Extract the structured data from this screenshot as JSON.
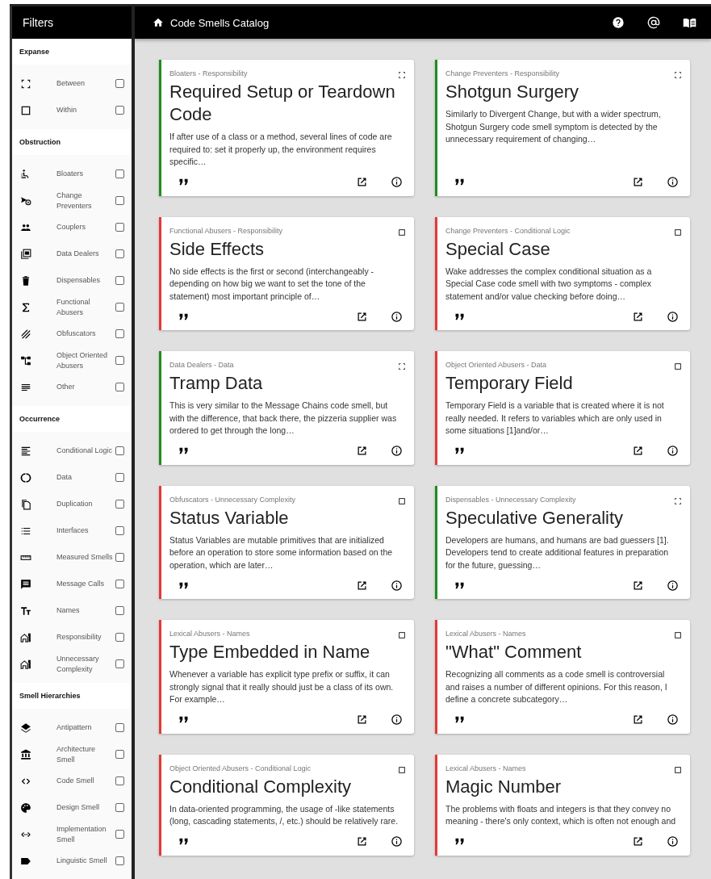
{
  "sidebar": {
    "title": "Filters",
    "sections": [
      {
        "title": "Expanse",
        "items": [
          {
            "label": "Between",
            "checked": false
          },
          {
            "label": "Within",
            "checked": false
          }
        ]
      },
      {
        "title": "Obstruction",
        "items": [
          {
            "label": "Bloaters",
            "checked": false
          },
          {
            "label": "Change Preventers",
            "checked": false
          },
          {
            "label": "Couplers",
            "checked": false
          },
          {
            "label": "Data Dealers",
            "checked": false
          },
          {
            "label": "Dispensables",
            "checked": false
          },
          {
            "label": "Functional Abusers",
            "checked": false
          },
          {
            "label": "Obfuscators",
            "checked": false
          },
          {
            "label": "Object Oriented Abusers",
            "checked": false
          },
          {
            "label": "Other",
            "checked": false
          }
        ]
      },
      {
        "title": "Occurrence",
        "items": [
          {
            "label": "Conditional Logic",
            "checked": false
          },
          {
            "label": "Data",
            "checked": false
          },
          {
            "label": "Duplication",
            "checked": false
          },
          {
            "label": "Interfaces",
            "checked": false
          },
          {
            "label": "Measured Smells",
            "checked": false
          },
          {
            "label": "Message Calls",
            "checked": false
          },
          {
            "label": "Names",
            "checked": false
          },
          {
            "label": "Responsibility",
            "checked": false
          },
          {
            "label": "Unnecessary Complexity",
            "checked": false
          }
        ]
      },
      {
        "title": "Smell Hierarchies",
        "items": [
          {
            "label": "Antipattern",
            "checked": false
          },
          {
            "label": "Architecture Smell",
            "checked": false
          },
          {
            "label": "Code Smell",
            "checked": false
          },
          {
            "label": "Design Smell",
            "checked": false
          },
          {
            "label": "Implementation Smell",
            "checked": false
          },
          {
            "label": "Linguistic Smell",
            "checked": false
          }
        ]
      }
    ]
  },
  "header": {
    "title": "Code Smells Catalog"
  },
  "cards": [
    {
      "category": "Bloaters - Responsibility",
      "title": "Required Setup or Teardown Code",
      "description": "If after use of a class or a method, several lines of code are required to: set it properly up, the environment requires specific…",
      "color": "#1e8e1e",
      "kind": "between"
    },
    {
      "category": "Change Preventers - Responsibility",
      "title": "Shotgun Surgery",
      "description": "Similarly to Divergent Change, but with a wider spectrum, Shotgun Surgery code smell symptom is detected by the unnecessary requirement of changing…",
      "color": "#1e8e1e",
      "kind": "between"
    },
    {
      "category": "Functional Abusers - Responsibility",
      "title": "Side Effects",
      "description": "No side effects is the first or second (interchangeably - depending on how big we want to set the tone of the statement) most important principle of…",
      "color": "#e53935",
      "kind": "within"
    },
    {
      "category": "Change Preventers - Conditional Logic",
      "title": "Special Case",
      "description": "Wake addresses the complex conditional situation as a Special Case code smell with two symptoms - complex statement and/or value checking before doing…",
      "color": "#e53935",
      "kind": "within"
    },
    {
      "category": "Data Dealers - Data",
      "title": "Tramp Data",
      "description": "This is very similar to the Message Chains code smell, but with the difference, that back there, the pizzeria supplier was ordered to get through the long…",
      "color": "#1e8e1e",
      "kind": "between"
    },
    {
      "category": "Object Oriented Abusers - Data",
      "title": "Temporary Field",
      "description": "Temporary Field is a variable that is created where it is not really needed. It refers to variables which are only used in some situations [1]and/or…",
      "color": "#e53935",
      "kind": "within"
    },
    {
      "category": "Obfuscators - Unnecessary Complexity",
      "title": "Status Variable",
      "description": "Status Variables are mutable primitives that are initialized before an operation to store some information based on the operation, which are later…",
      "color": "#e53935",
      "kind": "within"
    },
    {
      "category": "Dispensables - Unnecessary Complexity",
      "title": "Speculative Generality",
      "description": "Developers are humans, and humans are bad guessers [1]. Developers tend to create additional features in preparation for the future, guessing…",
      "color": "#1e8e1e",
      "kind": "between"
    },
    {
      "category": "Lexical Abusers - Names",
      "title": "Type Embedded in Name",
      "description": "Whenever a variable has explicit type prefix or suffix, it can strongly signal that it really should just be a class of its own. For example…",
      "color": "#e53935",
      "kind": "within"
    },
    {
      "category": "Lexical Abusers - Names",
      "title": "\"What\" Comment",
      "description": "Recognizing all comments as a code smell is controversial and raises a number of different opinions. For this reason, I define a concrete subcategory…",
      "color": "#e53935",
      "kind": "within"
    },
    {
      "category": "Object Oriented Abusers - Conditional Logic",
      "title": "Conditional Complexity",
      "description": "In data-oriented programming, the usage of -like statements (long, cascading statements, /, etc.) should be relatively rare.",
      "color": "#e53935",
      "kind": "within"
    },
    {
      "category": "Lexical Abusers - Names",
      "title": "Magic Number",
      "description": "The problems with floats and integers is that they convey no meaning - there's only context, which is often not enough and",
      "color": "#e53935",
      "kind": "within"
    }
  ]
}
